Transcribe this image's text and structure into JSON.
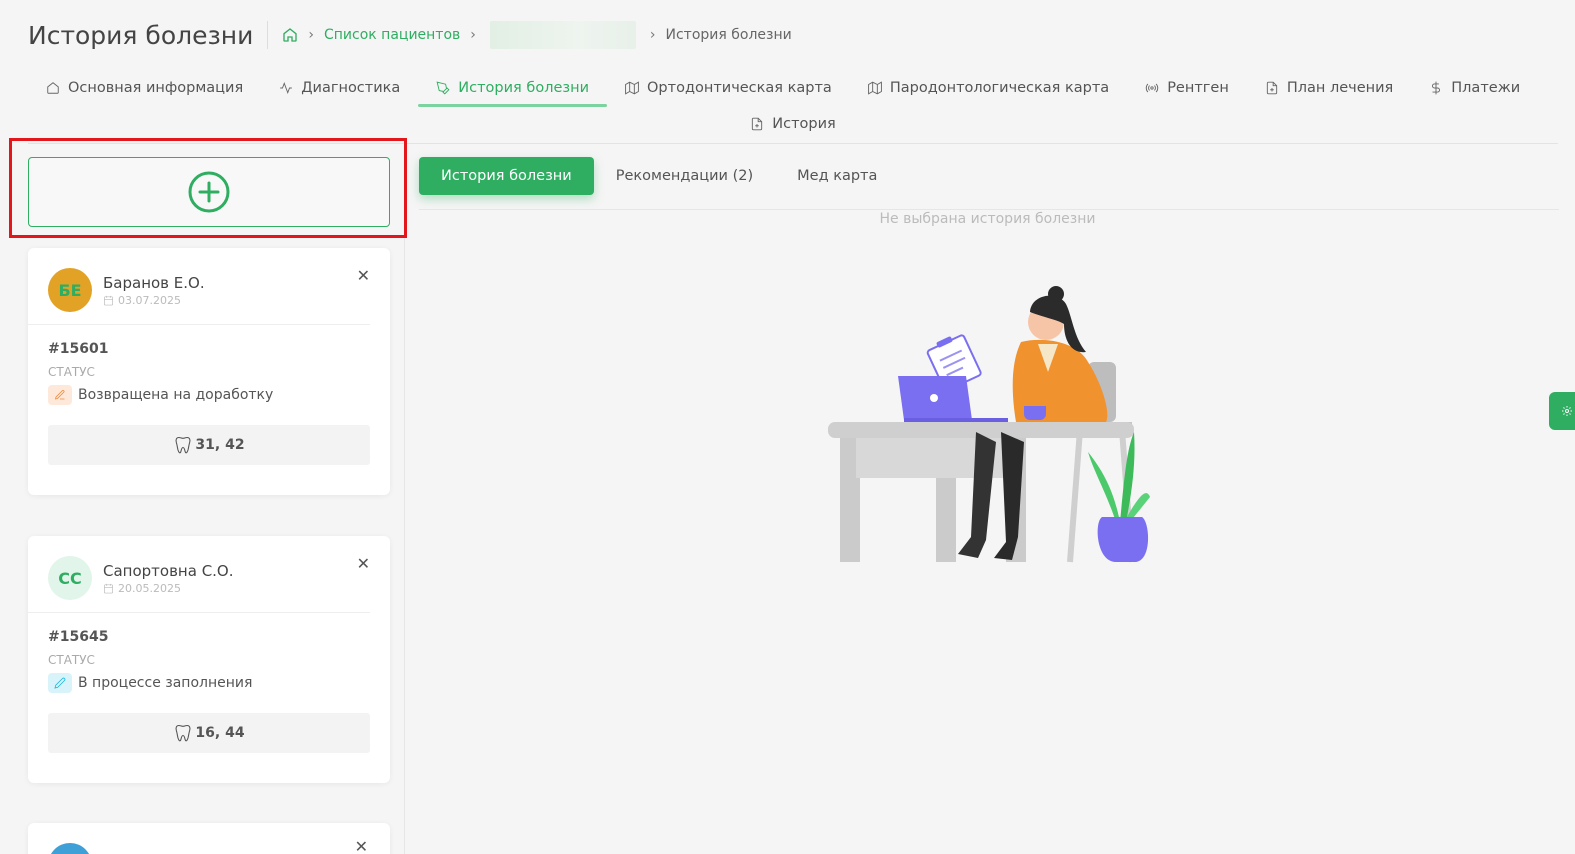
{
  "header": {
    "title": "История болезни",
    "breadcrumb": {
      "patients_link": "Список пациентов",
      "current": "История болезни"
    }
  },
  "tabs": [
    {
      "label": "Основная информация",
      "icon": "home-icon"
    },
    {
      "label": "Диагностика",
      "icon": "activity-icon"
    },
    {
      "label": "История болезни",
      "icon": "pen-tool-icon"
    },
    {
      "label": "Ортодонтическая карта",
      "icon": "map-icon"
    },
    {
      "label": "Пародонтологическая карта",
      "icon": "map-icon"
    },
    {
      "label": "Рентген",
      "icon": "radio-icon"
    },
    {
      "label": "План лечения",
      "icon": "file-icon"
    },
    {
      "label": "Платежи",
      "icon": "dollar-icon"
    },
    {
      "label": "История",
      "icon": "file-icon"
    }
  ],
  "subtabs": [
    {
      "label": "История болезни"
    },
    {
      "label": "Рекомендации (2)"
    },
    {
      "label": "Мед карта"
    }
  ],
  "empty_state": "Не выбрана история болезни",
  "cards": [
    {
      "initials": "БЕ",
      "name": "Баранов Е.О.",
      "date": "03.07.2025",
      "number": "#15601",
      "status_label": "СТАТУС",
      "status": "Возвращена на доработку",
      "teeth": "31, 42"
    },
    {
      "initials": "СС",
      "name": "Сапортовна С.О.",
      "date": "20.05.2025",
      "number": "#15645",
      "status_label": "СТАТУС",
      "status": "В процессе заполнения",
      "teeth": "16, 44"
    }
  ],
  "colors": {
    "accent": "#2fae62",
    "highlight": "#e3171b",
    "avatar1_bg": "#e2a226",
    "avatar2_bg": "#e2f5ea"
  }
}
